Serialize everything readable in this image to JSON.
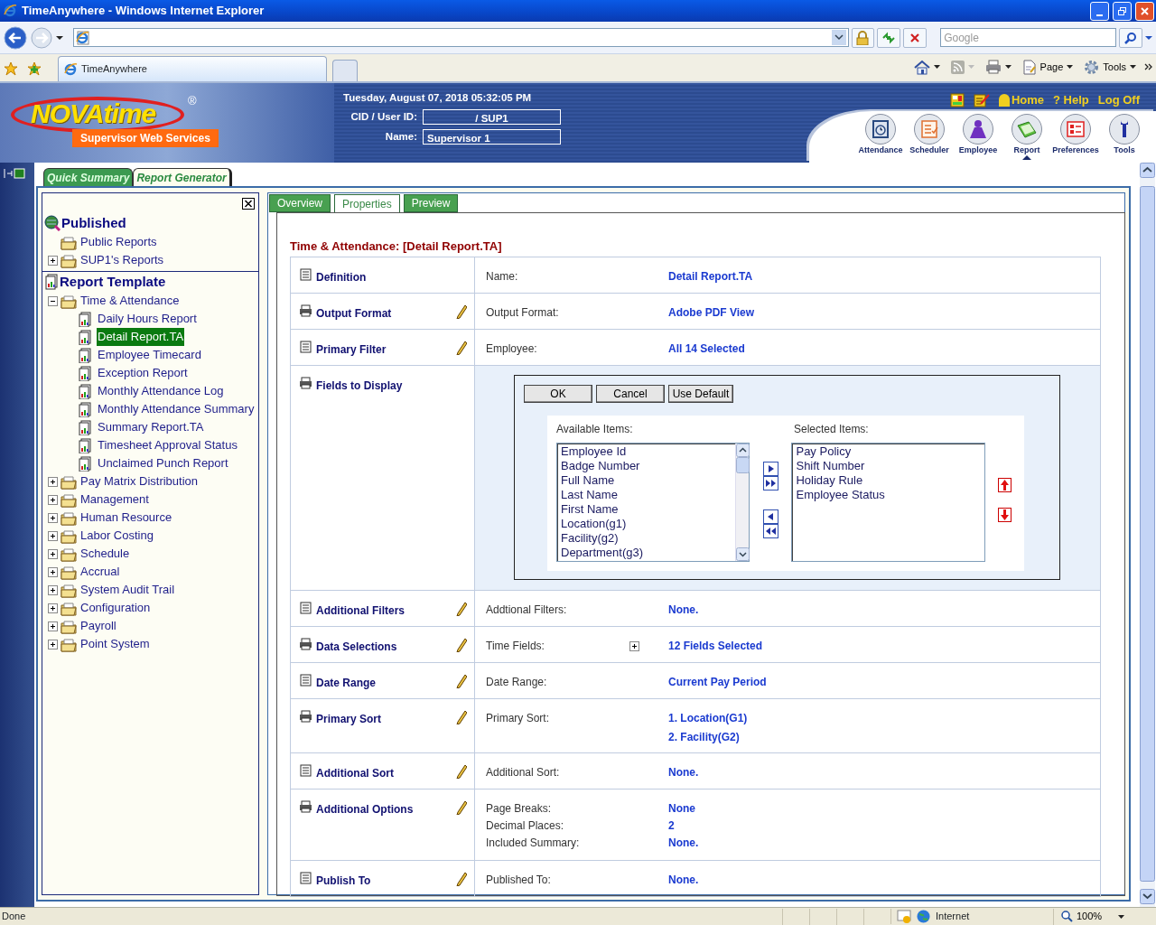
{
  "window": {
    "title": "TimeAnywhere - Windows Internet Explorer"
  },
  "browser": {
    "search_placeholder": "Google",
    "tabs": [
      {
        "label": "TimeAnywhere",
        "selected": true
      }
    ],
    "commands": [
      "Page",
      "Tools"
    ]
  },
  "header": {
    "logo": "NOVAtime",
    "logo_mark": "®",
    "subtitle": "Supervisor Web Services",
    "datetime": "Tuesday, August 07, 2018 05:32:05 PM",
    "fields": [
      {
        "label": "CID / User ID:",
        "value": "/ SUP1"
      },
      {
        "label": "Name:",
        "value": "Supervisor 1"
      }
    ],
    "links": [
      {
        "kind": "home",
        "label": "Home"
      },
      {
        "kind": "help",
        "glyph": "?",
        "label": "Help"
      },
      {
        "kind": "plain",
        "label": "Log Off"
      }
    ],
    "nav": [
      {
        "label": "Attendance",
        "selected": false
      },
      {
        "label": "Scheduler",
        "selected": false
      },
      {
        "label": "Employee",
        "selected": false
      },
      {
        "label": "Report",
        "selected": true
      },
      {
        "label": "Preferences",
        "selected": false
      },
      {
        "label": "Tools",
        "selected": false
      }
    ]
  },
  "page_tabs": [
    {
      "label": "Quick Summary",
      "selected": false
    },
    {
      "label": "Report Generator",
      "selected": true
    }
  ],
  "tree": [
    {
      "title": "Published",
      "items": [
        {
          "kind": "folder",
          "label": "Public Reports"
        },
        {
          "kind": "folder",
          "label": "SUP1's Reports",
          "expanded": false
        }
      ]
    },
    {
      "title": "Report Template",
      "items": [
        {
          "kind": "folder",
          "label": "Time & Attendance",
          "expanded": true,
          "children": [
            {
              "kind": "report",
              "label": "Daily Hours Report",
              "selected": false
            },
            {
              "kind": "report",
              "label": "Detail Report.TA",
              "selected": true
            },
            {
              "kind": "report",
              "label": "Employee Timecard",
              "selected": false
            },
            {
              "kind": "report",
              "label": "Exception Report",
              "selected": false
            },
            {
              "kind": "report",
              "label": "Monthly Attendance Log",
              "selected": false
            },
            {
              "kind": "report",
              "label": "Monthly Attendance Summary",
              "selected": false
            },
            {
              "kind": "report",
              "label": "Summary Report.TA",
              "selected": false
            },
            {
              "kind": "report",
              "label": "Timesheet Approval Status",
              "selected": false
            },
            {
              "kind": "report",
              "label": "Unclaimed Punch Report",
              "selected": false
            }
          ]
        },
        {
          "kind": "folder",
          "label": "Pay Matrix Distribution",
          "expanded": false
        },
        {
          "kind": "folder",
          "label": "Management",
          "expanded": false
        },
        {
          "kind": "folder",
          "label": "Human Resource",
          "expanded": false
        },
        {
          "kind": "folder",
          "label": "Labor Costing",
          "expanded": false
        },
        {
          "kind": "folder",
          "label": "Schedule",
          "expanded": false
        },
        {
          "kind": "folder",
          "label": "Accrual",
          "expanded": false
        },
        {
          "kind": "folder",
          "label": "System Audit Trail",
          "expanded": false
        },
        {
          "kind": "folder",
          "label": "Configuration",
          "expanded": false
        },
        {
          "kind": "folder",
          "label": "Payroll",
          "expanded": false
        },
        {
          "kind": "folder",
          "label": "Point System",
          "expanded": false
        }
      ]
    }
  ],
  "report_tabs": [
    {
      "label": "Overview",
      "selected": false
    },
    {
      "label": "Properties",
      "selected": true
    },
    {
      "label": "Preview",
      "selected": false
    }
  ],
  "report_title": "Time & Attendance: [Detail Report.TA]",
  "properties": [
    {
      "kind": "entries",
      "title": "Definition",
      "editable": false,
      "entries": [
        {
          "label": "Name:",
          "values": [
            "Detail Report.TA"
          ]
        }
      ]
    },
    {
      "kind": "entries",
      "title": "Output Format",
      "editable": true,
      "entries": [
        {
          "label": "Output Format:",
          "values": [
            "Adobe PDF View"
          ]
        }
      ]
    },
    {
      "kind": "entries",
      "title": "Primary Filter",
      "editable": true,
      "entries": [
        {
          "label": "Employee:",
          "values": [
            "All 14 Selected"
          ]
        }
      ]
    },
    {
      "kind": "picker",
      "title": "Fields to Display",
      "editable": false,
      "picker": {
        "buttons": [
          "OK",
          "Cancel",
          "Use Default"
        ],
        "available_label": "Available Items:",
        "available": [
          "Employee Id",
          "Badge Number",
          "Full Name",
          "Last Name",
          "First Name",
          "Location(g1)",
          "Facility(g2)",
          "Department(g3)"
        ],
        "selected_label": "Selected Items:",
        "selected": [
          "Pay Policy",
          "Shift Number",
          "Holiday Rule",
          "Employee Status"
        ]
      }
    },
    {
      "kind": "entries",
      "title": "Additional Filters",
      "editable": true,
      "entries": [
        {
          "label": "Addtional Filters:",
          "values": [
            "None."
          ]
        }
      ]
    },
    {
      "kind": "entries",
      "title": "Data Selections",
      "editable": true,
      "entries": [
        {
          "label": "Time Fields:",
          "expanded": false,
          "values": [
            "12 Fields Selected"
          ]
        }
      ]
    },
    {
      "kind": "entries",
      "title": "Date Range",
      "editable": true,
      "entries": [
        {
          "label": "Date Range:",
          "values": [
            "Current Pay Period"
          ]
        }
      ]
    },
    {
      "kind": "entries",
      "title": "Primary Sort",
      "editable": true,
      "entries": [
        {
          "label": "Primary Sort:",
          "values": [
            "1. Location(G1)",
            "2. Facility(G2)"
          ]
        }
      ]
    },
    {
      "kind": "entries",
      "title": "Additional Sort",
      "editable": true,
      "entries": [
        {
          "label": "Additional Sort:",
          "values": [
            "None."
          ]
        }
      ]
    },
    {
      "kind": "entries",
      "title": "Additional Options",
      "editable": true,
      "entries": [
        {
          "label": "Page Breaks:",
          "values": [
            "None"
          ]
        },
        {
          "label": "Decimal Places:",
          "values": [
            "2"
          ]
        },
        {
          "label": "Included Summary:",
          "values": [
            "None."
          ]
        }
      ]
    },
    {
      "kind": "entries",
      "title": "Publish To",
      "editable": true,
      "entries": [
        {
          "label": "Published To:",
          "values": [
            "None."
          ]
        }
      ]
    }
  ],
  "status_bar": {
    "text": "Done",
    "zone": "Internet",
    "zoom": "100%"
  }
}
